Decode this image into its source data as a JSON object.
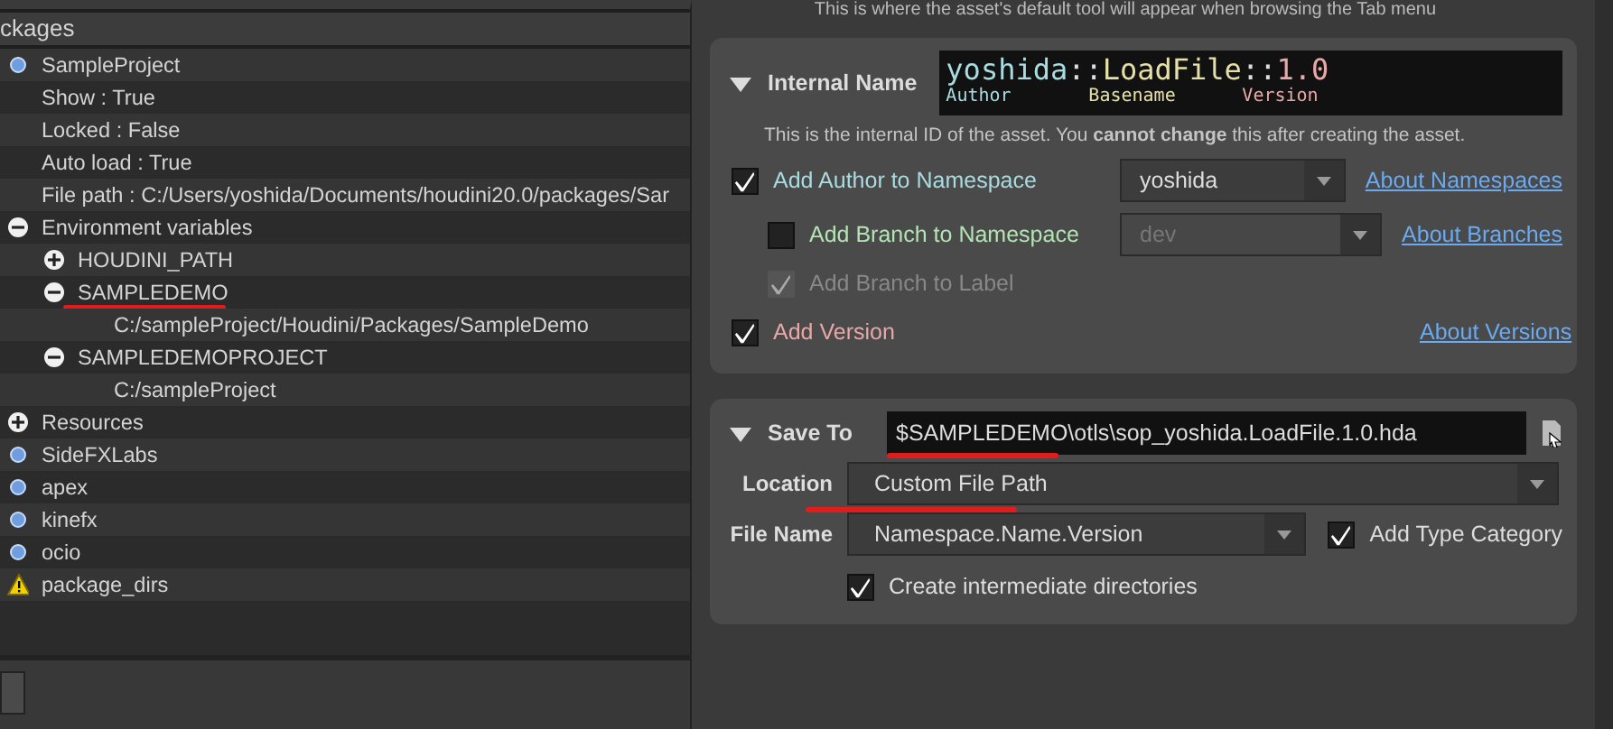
{
  "packages_panel": {
    "title": "ckages",
    "tree": [
      {
        "label": "SampleProject",
        "kind": "package",
        "children": [
          {
            "label": "Show : True",
            "kind": "property"
          },
          {
            "label": "Locked : False",
            "kind": "property"
          },
          {
            "label": "Auto load : True",
            "kind": "property"
          },
          {
            "label": "File path : C:/Users/yoshida/Documents/houdini20.0/packages/Sar",
            "kind": "property"
          },
          {
            "label": "Environment variables",
            "kind": "group",
            "expanded": true,
            "children": [
              {
                "label": "HOUDINI_PATH",
                "kind": "group",
                "expanded": false
              },
              {
                "label": "SAMPLEDEMO",
                "kind": "group",
                "expanded": true,
                "annotated": true,
                "children": [
                  {
                    "label": "C:/sampleProject/Houdini/Packages/SampleDemo",
                    "kind": "property"
                  }
                ]
              },
              {
                "label": "SAMPLEDEMOPROJECT",
                "kind": "group",
                "expanded": true,
                "children": [
                  {
                    "label": "C:/sampleProject",
                    "kind": "property"
                  }
                ]
              }
            ]
          },
          {
            "label": "Resources",
            "kind": "group",
            "expanded": false
          }
        ]
      },
      {
        "label": "SideFXLabs",
        "kind": "package"
      },
      {
        "label": "apex",
        "kind": "package"
      },
      {
        "label": "kinefx",
        "kind": "package"
      },
      {
        "label": "ocio",
        "kind": "package"
      },
      {
        "label": "package_dirs",
        "kind": "warning"
      }
    ]
  },
  "asset_dialog": {
    "tab_menu_note": "This is where the asset's default tool will appear when browsing the Tab menu",
    "internal_name": {
      "title": "Internal Name",
      "expanded": true,
      "parts": [
        {
          "text": "yoshida",
          "label": "Author",
          "color": "#a8dce0"
        },
        {
          "text": "LoadFile",
          "label": "Basename",
          "color": "#e6e0a8"
        },
        {
          "text": "1.0",
          "label": "Version",
          "color": "#e8a8a8"
        }
      ],
      "separator": "::",
      "note": "This is the internal ID of the asset. You **cannot change** this after creating the asset.",
      "options": [
        {
          "label": "Add Author to Namespace",
          "kind": "main",
          "checked": true,
          "disabled": false,
          "color": "#a8dce0",
          "dropdown": {
            "value": "yoshida",
            "disabled": false
          },
          "link": "About Namespaces"
        },
        {
          "label": "Add Branch to Namespace",
          "kind": "sub",
          "checked": false,
          "disabled": false,
          "color": "#b4e4b4",
          "dropdown": {
            "value": "dev",
            "disabled": true
          },
          "link": "About Branches"
        },
        {
          "label": "Add Branch to Label",
          "kind": "sub",
          "checked": true,
          "disabled": true
        },
        {
          "label": "Add Version",
          "kind": "main",
          "checked": true,
          "disabled": false,
          "color": "#e8a8a8",
          "link": "About Versions"
        }
      ]
    },
    "save_to": {
      "title": "Save To",
      "expanded": true,
      "path": "$SAMPLEDEMO\\otls\\sop_yoshida.LoadFile.1.0.hda",
      "path_annotated": true,
      "location_label": "Location",
      "location": "Custom File Path",
      "location_annotated": true,
      "file_name_label": "File Name",
      "file_name": "Namespace.Name.Version",
      "add_type_category": {
        "label": "Add Type Category",
        "checked": true
      },
      "create_dirs": {
        "label": "Create intermediate directories",
        "checked": true
      }
    }
  }
}
